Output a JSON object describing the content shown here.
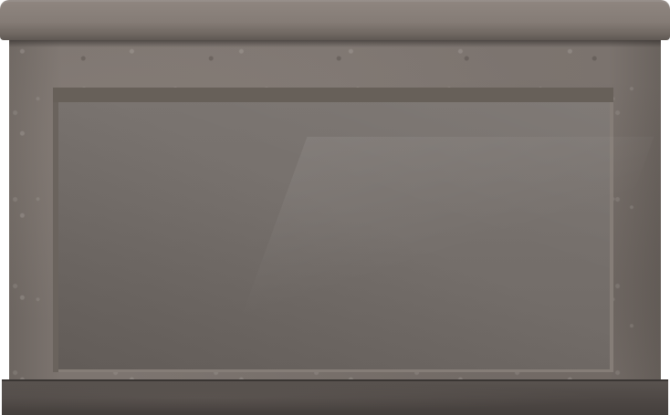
{
  "scene": {
    "object": "stone-pedestal-panel",
    "colors": {
      "cap": "#857c76",
      "body": "#7e7671",
      "panel": "#77716d",
      "panel_edge": "#676059",
      "base": "#4d4744"
    }
  }
}
